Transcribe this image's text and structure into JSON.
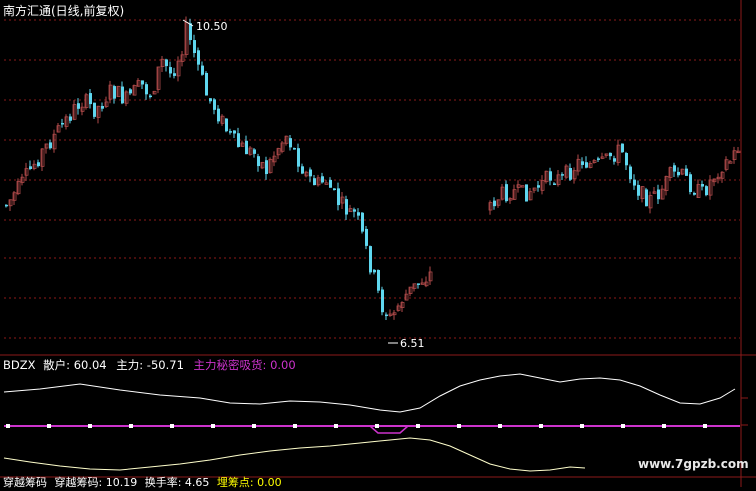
{
  "header": {
    "title": "南方汇通(日线,前复权)"
  },
  "price_chart": {
    "high_marker": "10.50",
    "low_marker": "6.51"
  },
  "indicator": {
    "label": "BDZX",
    "items": [
      {
        "label": "散户: 60.04",
        "color": "#ffffff"
      },
      {
        "label": "主力: -50.71",
        "color": "#ffffff"
      },
      {
        "label": "主力秘密吸货: 0.00",
        "color": "#cc33cc"
      }
    ]
  },
  "footer": {
    "items": [
      {
        "label": "穿越筹码",
        "color": "#ffffff"
      },
      {
        "label": "穿越筹码: 10.19",
        "color": "#ffffff"
      },
      {
        "label": "换手率: 4.65",
        "color": "#ffffff"
      },
      {
        "label": "埋筹点: 0.00",
        "color": "#ffff00"
      }
    ]
  },
  "watermark": "www.7gpzb.com",
  "colors": {
    "background": "#000000",
    "up_candle": "#b04a4a",
    "down_candle": "#5fd7ef",
    "grid": "#8c1a1a",
    "sanhu_line": "#ffffff",
    "zhuli_line": "#ffffcc",
    "secret_line": "#cc33cc"
  },
  "chart_data": [
    {
      "type": "candlestick",
      "title": "南方汇通(日线,前复权)",
      "annotations": [
        {
          "text": "10.50",
          "meaning": "period high"
        },
        {
          "text": "6.51",
          "meaning": "period low"
        }
      ],
      "grid": true
    },
    {
      "type": "line",
      "title": "BDZX",
      "series": [
        {
          "name": "散户",
          "last": 60.04
        },
        {
          "name": "主力",
          "last": -50.71
        },
        {
          "name": "主力秘密吸货",
          "last": 0.0
        }
      ]
    }
  ]
}
